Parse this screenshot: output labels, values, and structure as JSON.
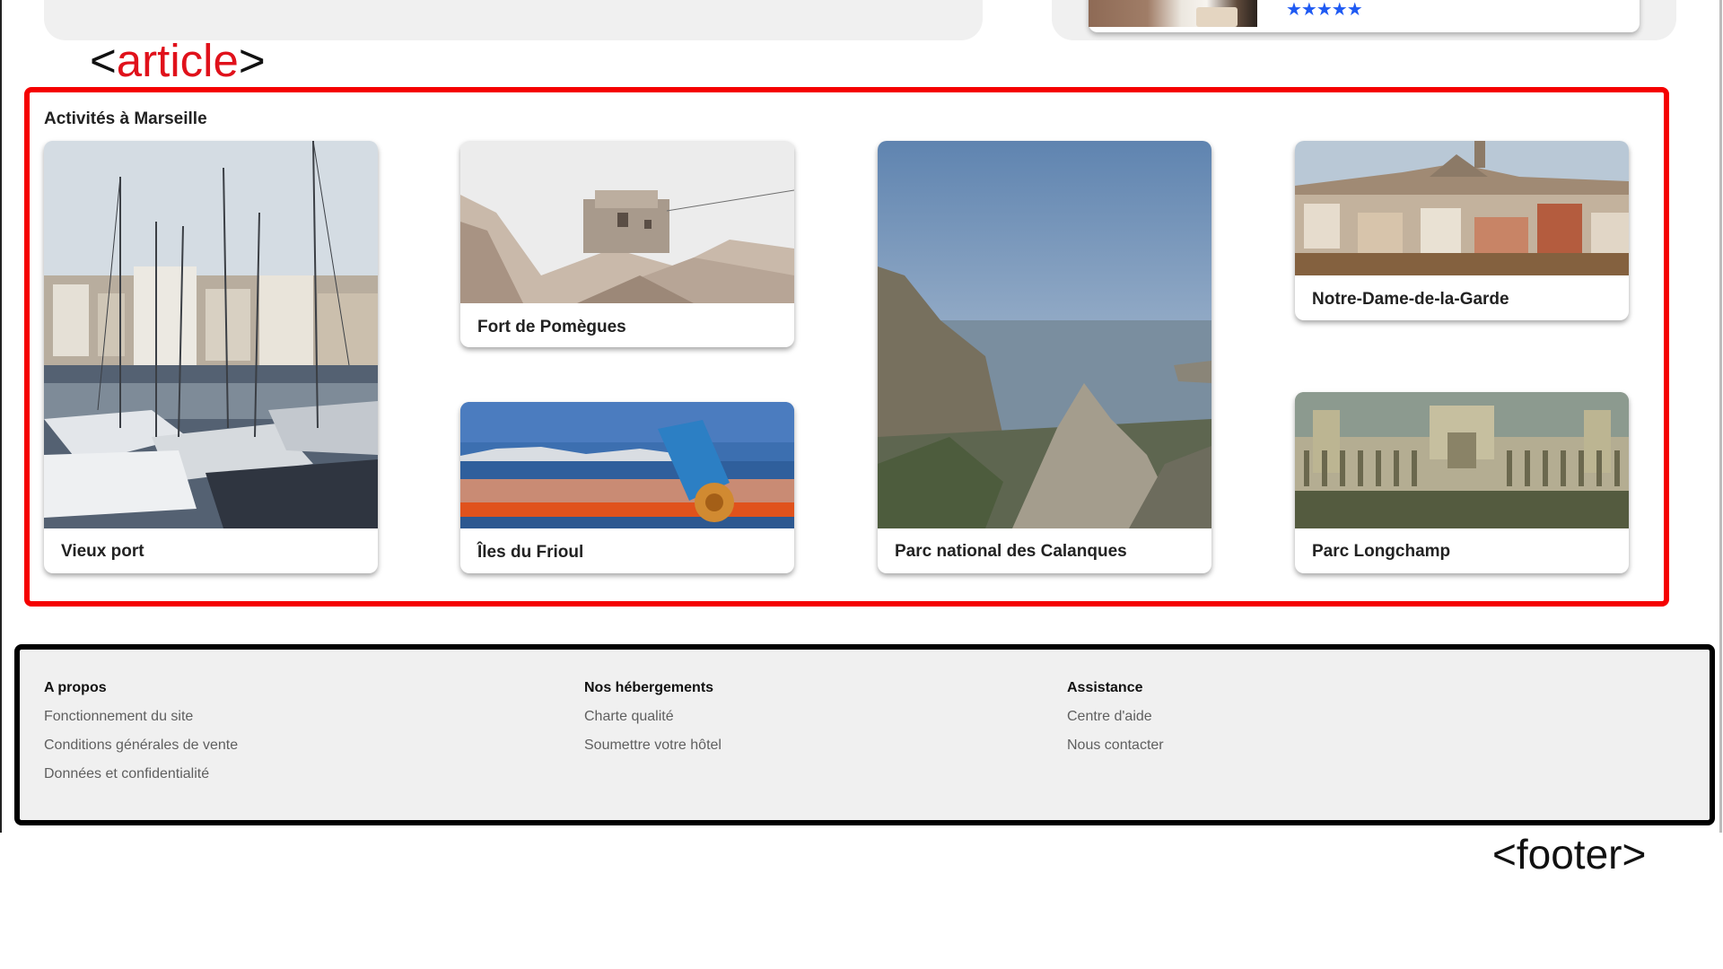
{
  "top_card": {
    "rating_stars": "★★★★★",
    "star_color": "#1f5af3"
  },
  "labels": {
    "article_open": "<",
    "article_name": "article",
    "article_close": ">",
    "footer": "<footer>"
  },
  "article": {
    "title": "Activités à Marseille",
    "border_color": "#f50000",
    "cards": [
      {
        "caption": "Vieux port",
        "image": "harbor-sailboats-photo"
      },
      {
        "caption": "Fort de Pomègues",
        "image": "island-fort-photo"
      },
      {
        "caption": "Îles du Frioul",
        "image": "sea-telescope-photo"
      },
      {
        "caption": "Parc national des Calanques",
        "image": "calanques-cliffs-photo"
      },
      {
        "caption": "Notre-Dame-de-la-Garde",
        "image": "city-basilica-photo"
      },
      {
        "caption": "Parc Longchamp",
        "image": "palace-colonnade-photo"
      }
    ]
  },
  "footer": {
    "border_color": "#000000",
    "columns": [
      {
        "heading": "A propos",
        "links": [
          "Fonctionnement du site",
          "Conditions générales de vente",
          "Données et confidentialité"
        ]
      },
      {
        "heading": "Nos hébergements",
        "links": [
          "Charte qualité",
          "Soumettre votre hôtel"
        ]
      },
      {
        "heading": "Assistance",
        "links": [
          "Centre d'aide",
          "Nous contacter"
        ]
      }
    ]
  }
}
